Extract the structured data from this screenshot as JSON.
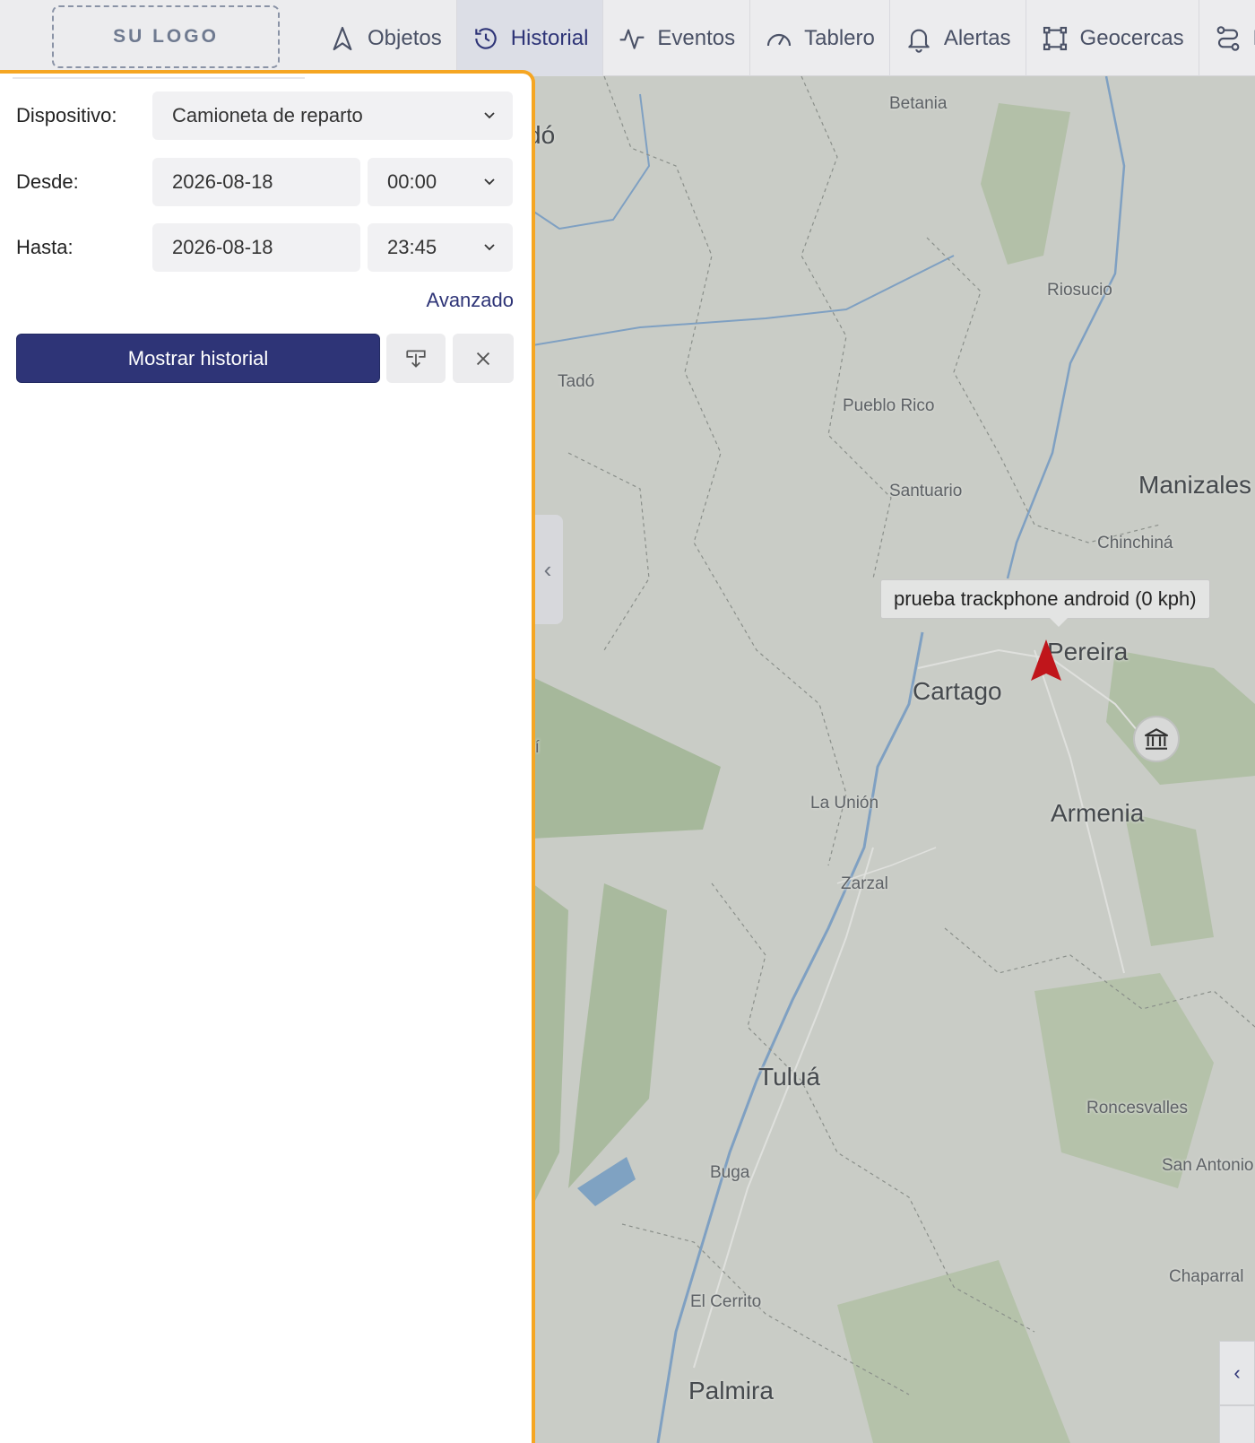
{
  "header": {
    "logo": "SU LOGO",
    "nav": [
      {
        "label": "Objetos",
        "icon": "navigation-arrow-icon",
        "active": false
      },
      {
        "label": "Historial",
        "icon": "history-clock-icon",
        "active": true
      },
      {
        "label": "Eventos",
        "icon": "activity-pulse-icon",
        "active": false
      },
      {
        "label": "Tablero",
        "icon": "gauge-icon",
        "active": false
      },
      {
        "label": "Alertas",
        "icon": "bell-icon",
        "active": false
      },
      {
        "label": "Geocercas",
        "icon": "geofence-icon",
        "active": false
      },
      {
        "label": "R",
        "icon": "route-icon",
        "active": false
      }
    ]
  },
  "panel": {
    "device_label": "Dispositivo:",
    "device_value": "Camioneta de reparto",
    "from_label": "Desde:",
    "from_date": "2026-08-18",
    "from_time": "00:00",
    "to_label": "Hasta:",
    "to_date": "2026-08-18",
    "to_time": "23:45",
    "advanced_link": "Avanzado",
    "show_button": "Mostrar historial",
    "download_icon": "download-icon",
    "close_icon": "close-icon"
  },
  "map": {
    "tooltip": "prueba trackphone android (0 kph)",
    "marker_icon": "vehicle-arrow-icon",
    "poi_icon": "museum-icon",
    "collapse_icon": "chevron-left-icon",
    "cities": {
      "betania": "Betania",
      "do": "dó",
      "riosucio": "Riosucio",
      "tado": "Tadó",
      "pueblo_rico": "Pueblo Rico",
      "santuario": "Santuario",
      "manizales": "Manizales",
      "chinchina": "Chinchiná",
      "pereira": "Pereira",
      "cartago": "Cartago",
      "pi": "pí",
      "la_union": "La Unión",
      "armenia": "Armenia",
      "zarzal": "Zarzal",
      "tulua": "Tuluá",
      "roncesvalles": "Roncesvalles",
      "san_antonio": "San Antonio",
      "buga": "Buga",
      "chaparral": "Chaparral",
      "el_cerrito": "El Cerrito",
      "palmira": "Palmira"
    }
  },
  "colors": {
    "accent": "#2e3477",
    "panel_border": "#f5a623",
    "marker": "#c0151b"
  }
}
